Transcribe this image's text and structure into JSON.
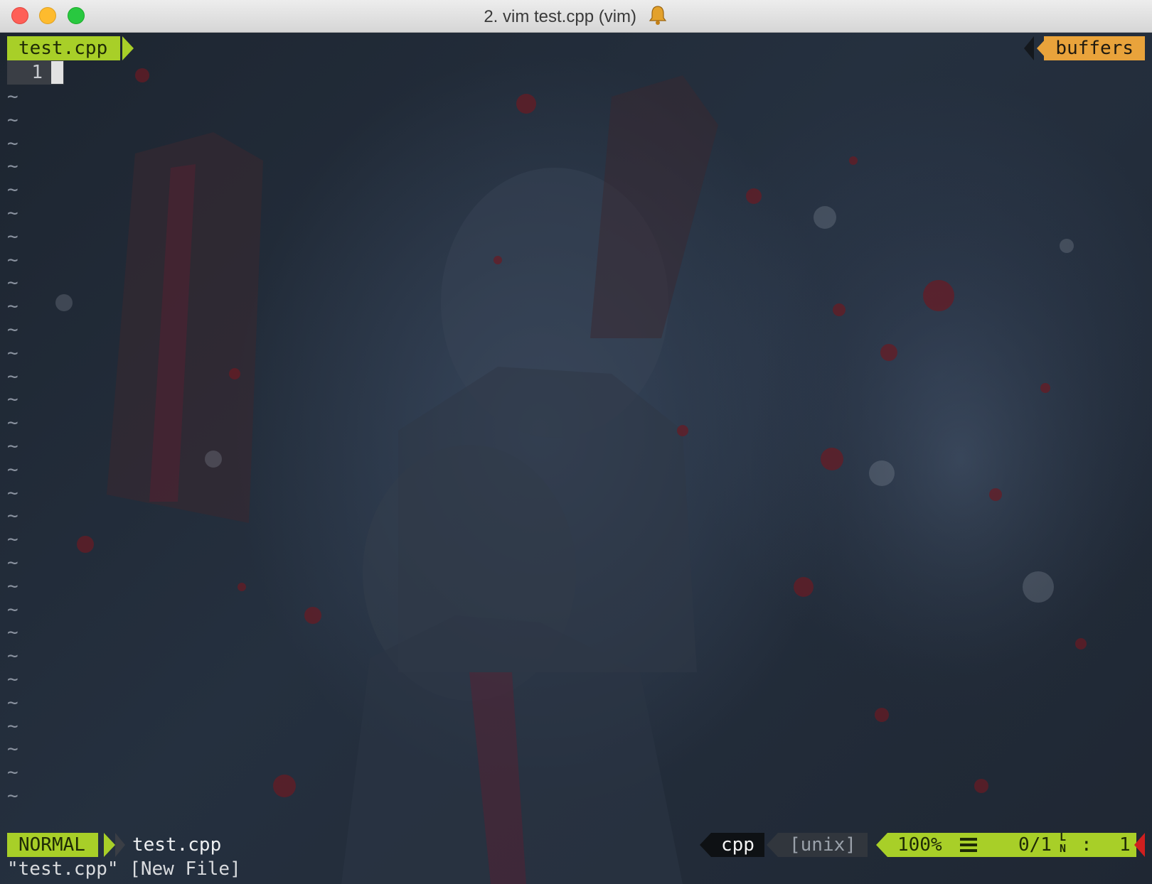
{
  "window": {
    "title": "2. vim test.cpp (vim)",
    "title_icon": "bell-icon",
    "traffic_lights": {
      "close": "#fe5f57",
      "minimize": "#febb2e",
      "maximize": "#29c840"
    }
  },
  "tabline": {
    "file": "test.cpp",
    "buffers_label": "buffers"
  },
  "editor": {
    "line_number": "1",
    "empty_line_marker": "~",
    "empty_line_count": 31
  },
  "statusline": {
    "mode": "NORMAL",
    "filename": "test.cpp",
    "filetype": "cpp",
    "fileformat": "[unix]",
    "percent": "100%",
    "column": "0/1",
    "ln_icon": "LN",
    "ln_separator": ":",
    "line": "1"
  },
  "message": "\"test.cpp\" [New File]",
  "colors": {
    "accent_green": "#a8cf28",
    "accent_orange": "#e9a33b",
    "accent_red": "#d01f1f"
  }
}
